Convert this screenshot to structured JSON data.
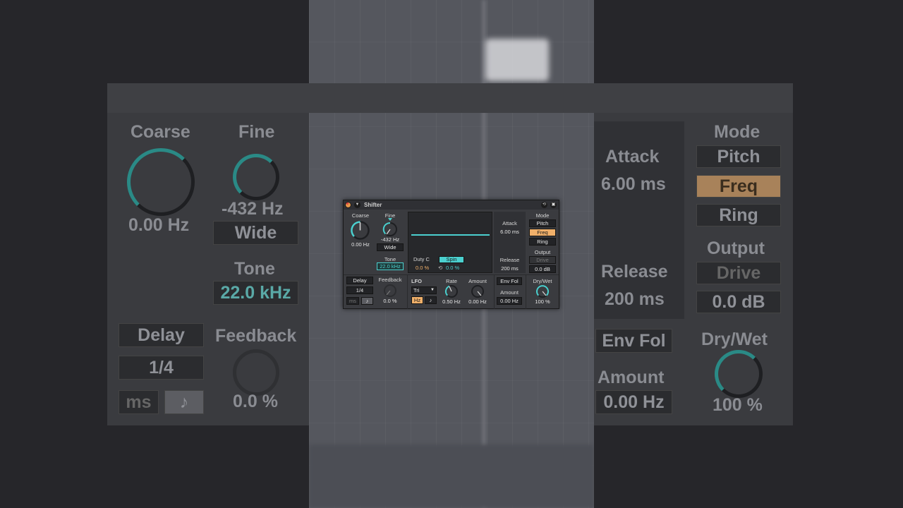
{
  "device": {
    "title": "Shifter",
    "fold_glyph": "▼",
    "hotswap_glyph": "⟲",
    "save_glyph": "▣"
  },
  "pitch": {
    "coarse_label": "Coarse",
    "coarse_value": "0.00 Hz",
    "fine_label": "Fine",
    "fine_value": "-432 Hz",
    "wide_label": "Wide",
    "tone_label": "Tone",
    "tone_value": "22.0 kHz"
  },
  "delay": {
    "delay_label": "Delay",
    "division": "1/4",
    "ms_label": "ms",
    "note_label": "♪",
    "feedback_label": "Feedback",
    "feedback_value": "0.0 %"
  },
  "display": {
    "duty_label": "Duty C",
    "duty_value": "0.0 %",
    "spin_label": "Spin",
    "spin_icon": "⟲",
    "spin_value": "0.0 %"
  },
  "envelope": {
    "attack_label": "Attack",
    "attack_value": "6.00 ms",
    "release_label": "Release",
    "release_value": "200 ms",
    "envfol_label": "Env Fol",
    "amount_label": "Amount",
    "amount_value": "0.00 Hz"
  },
  "lfo": {
    "lfo_label": "LFO",
    "waveform": "Tri",
    "waveform_arrow": "▼",
    "hz_label": "Hz",
    "note_label": "♪",
    "rate_label": "Rate",
    "rate_value": "0.50 Hz",
    "amount_label": "Amount",
    "amount_value": "0.00 Hz"
  },
  "mode": {
    "mode_label": "Mode",
    "options": [
      "Pitch",
      "Freq",
      "Ring"
    ],
    "selected": "Freq",
    "output_label": "Output",
    "drive_label": "Drive",
    "output_value": "0.0 dB",
    "drywet_label": "Dry/Wet",
    "drywet_value": "100 %"
  },
  "colors": {
    "accent_teal": "#4bd0cf",
    "accent_orange": "#f0b06a",
    "panel": "#3a3b3f"
  }
}
